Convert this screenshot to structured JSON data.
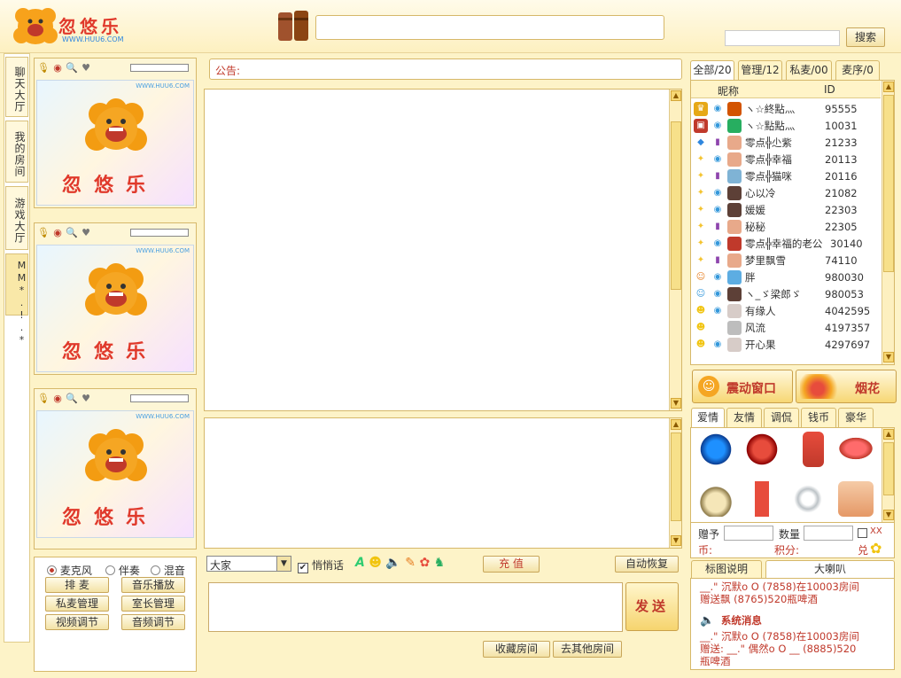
{
  "header": {
    "logo_text": "忽悠乐",
    "logo_url": "WWW.HUU6.COM",
    "search_placeholder": "",
    "search_button": "搜索"
  },
  "sidebar_tabs": [
    "聊天大厅",
    "我的房间",
    "游戏大厅",
    "MM*.!.*"
  ],
  "video_panels": [
    {
      "logo_text": "忽悠乐",
      "logo_url": "WWW.HUU6.COM"
    },
    {
      "logo_text": "忽悠乐",
      "logo_url": "WWW.HUU6.COM"
    },
    {
      "logo_text": "忽悠乐",
      "logo_url": "WWW.HUU6.COM"
    }
  ],
  "audio_controls": {
    "radios": [
      "麦克风",
      "伴奏",
      "混音"
    ],
    "selected": "麦克风",
    "buttons": [
      "排 麦",
      "音乐播放",
      "私麦管理",
      "室长管理",
      "视频调节",
      "音频调节"
    ]
  },
  "announcement_label": "公告:",
  "chat_input": {
    "target": "大家",
    "whisper_label": "悄悄话",
    "recharge_button": "充 值",
    "auto_recover_button": "自动恢复",
    "send_button": "发送",
    "favorite_button": "收藏房间",
    "other_rooms_button": "去其他房间"
  },
  "user_list": {
    "tabs": [
      "全部/20",
      "管理/12",
      "私麦/00",
      "麦序/0"
    ],
    "col_nickname": "昵称",
    "col_id": "ID",
    "users": [
      {
        "name": "ヽ☆終點灬",
        "id": "95555",
        "badge": "#e6a817"
      },
      {
        "name": "ヽ☆點點灬",
        "id": "10031",
        "badge": "#c0392b"
      },
      {
        "name": "零点╬尐紫",
        "id": "21233",
        "badge": "#2e86de"
      },
      {
        "name": "零点╬幸福",
        "id": "20113",
        "badge": "#f4c430"
      },
      {
        "name": "零点╬猫咪",
        "id": "20116",
        "badge": "#f4c430"
      },
      {
        "name": "心以冷",
        "id": "21082",
        "badge": "#f4c430"
      },
      {
        "name": "媛媛",
        "id": "22303",
        "badge": "#f4c430"
      },
      {
        "name": "秘秘",
        "id": "22305",
        "badge": "#f4c430"
      },
      {
        "name": "零点╬幸福的老公",
        "id": "30140",
        "badge": "#f4c430"
      },
      {
        "name": "梦里飘雪",
        "id": "74110",
        "badge": "#f4c430"
      },
      {
        "name": "胖",
        "id": "980030",
        "badge": "#e67e22"
      },
      {
        "name": "ヽ_ゞ梁郎ゞ",
        "id": "980053",
        "badge": "#3498db"
      },
      {
        "name": "有缘人",
        "id": "4042595",
        "badge": "#f1c40f"
      },
      {
        "name": "风流",
        "id": "4197357",
        "badge": "#f1c40f"
      },
      {
        "name": "开心果",
        "id": "4297697",
        "badge": "#f1c40f"
      }
    ]
  },
  "effects": {
    "shake_button": "震动窗口",
    "firework_button": "烟花"
  },
  "gifts": {
    "tabs": [
      "爱情",
      "友情",
      "调侃",
      "钱币",
      "豪华"
    ],
    "give_label": "赠予",
    "quantity_label": "数量",
    "xx_label": "XX",
    "coin_label": "币:",
    "points_label": "积分:",
    "exchange_label": "兑"
  },
  "messages": {
    "tabs": [
      "标图说明",
      "大喇叭"
    ],
    "entries": [
      {
        "line1": "__.\" 沉默o O (7858)在10003房间",
        "line2": "赠送飘 (8765)520瓶啤酒"
      },
      {
        "title": "系统消息"
      },
      {
        "line1": "__.\" 沉默o O (7858)在10003房间",
        "line2": "赠送: __.\" 偶然o O __ (8885)520",
        "line3": "瓶啤酒"
      }
    ]
  }
}
